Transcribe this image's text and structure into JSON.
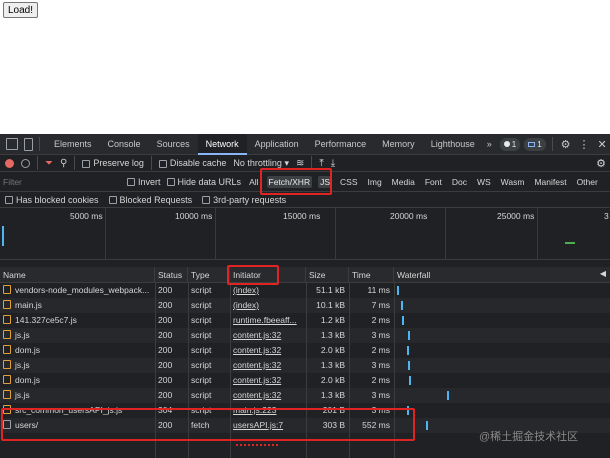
{
  "page": {
    "load_button": "Load!"
  },
  "devtools": {
    "tabs": [
      "Elements",
      "Console",
      "Sources",
      "Network",
      "Application",
      "Performance",
      "Memory",
      "Lighthouse"
    ],
    "more_tabs": "»",
    "badges": {
      "errors": "1",
      "messages": "1"
    },
    "toolbar": {
      "preserve_log": "Preserve log",
      "disable_cache": "Disable cache",
      "throttling": "No throttling"
    },
    "filter": {
      "placeholder": "Filter",
      "invert": "Invert",
      "hide_data_urls": "Hide data URLs",
      "types": [
        "All",
        "Fetch/XHR",
        "JS",
        "CSS",
        "Img",
        "Media",
        "Font",
        "Doc",
        "WS",
        "Wasm",
        "Manifest",
        "Other"
      ],
      "selected_type": "Fetch/XHR"
    },
    "blocked": {
      "has_blocked_cookies": "Has blocked cookies",
      "blocked_requests": "Blocked Requests",
      "third_party": "3rd-party requests"
    },
    "overview_ticks": [
      "5000 ms",
      "10000 ms",
      "15000 ms",
      "20000 ms",
      "25000 ms",
      "3"
    ],
    "columns": {
      "name": "Name",
      "status": "Status",
      "type": "Type",
      "initiator": "Initiator",
      "size": "Size",
      "time": "Time",
      "waterfall": "Waterfall"
    },
    "requests": [
      {
        "name": "vendors-node_modules_webpack...",
        "status": "200",
        "type": "script",
        "initiator": "(index)",
        "size": "51.1 kB",
        "time": "11 ms",
        "icon": "script-file-icon"
      },
      {
        "name": "main.js",
        "status": "200",
        "type": "script",
        "initiator": "(index)",
        "size": "10.1 kB",
        "time": "7 ms",
        "icon": "script-file-icon"
      },
      {
        "name": "141.327ce5c7.js",
        "status": "200",
        "type": "script",
        "initiator": "runtime.fbeeaff...",
        "size": "1.2 kB",
        "time": "2 ms",
        "icon": "script-file-icon"
      },
      {
        "name": "js.js",
        "status": "200",
        "type": "script",
        "initiator": "content.js:32",
        "size": "1.3 kB",
        "time": "3 ms",
        "icon": "script-file-icon"
      },
      {
        "name": "dom.js",
        "status": "200",
        "type": "script",
        "initiator": "content.js:32",
        "size": "2.0 kB",
        "time": "2 ms",
        "icon": "script-file-icon"
      },
      {
        "name": "js.js",
        "status": "200",
        "type": "script",
        "initiator": "content.js:32",
        "size": "1.3 kB",
        "time": "3 ms",
        "icon": "script-file-icon"
      },
      {
        "name": "dom.js",
        "status": "200",
        "type": "script",
        "initiator": "content.js:32",
        "size": "2.0 kB",
        "time": "2 ms",
        "icon": "script-file-icon"
      },
      {
        "name": "js.js",
        "status": "200",
        "type": "script",
        "initiator": "content.js:32",
        "size": "1.3 kB",
        "time": "3 ms",
        "icon": "script-file-icon"
      },
      {
        "name": "src_common_usersAPI_js.js",
        "status": "304",
        "type": "script",
        "initiator": "main.js:223",
        "size": "201 B",
        "time": "3 ms",
        "icon": "script-file-icon"
      },
      {
        "name": "users/",
        "status": "200",
        "type": "fetch",
        "initiator": "usersAPI.js:7",
        "size": "303 B",
        "time": "552 ms",
        "icon": "document-file-icon"
      }
    ],
    "colors": {
      "background": "#202124",
      "highlight": "#e02424",
      "waterfall_bar": "#4db6f0",
      "record": "#e46962"
    }
  },
  "watermark": "@稀土掘金技术社区"
}
